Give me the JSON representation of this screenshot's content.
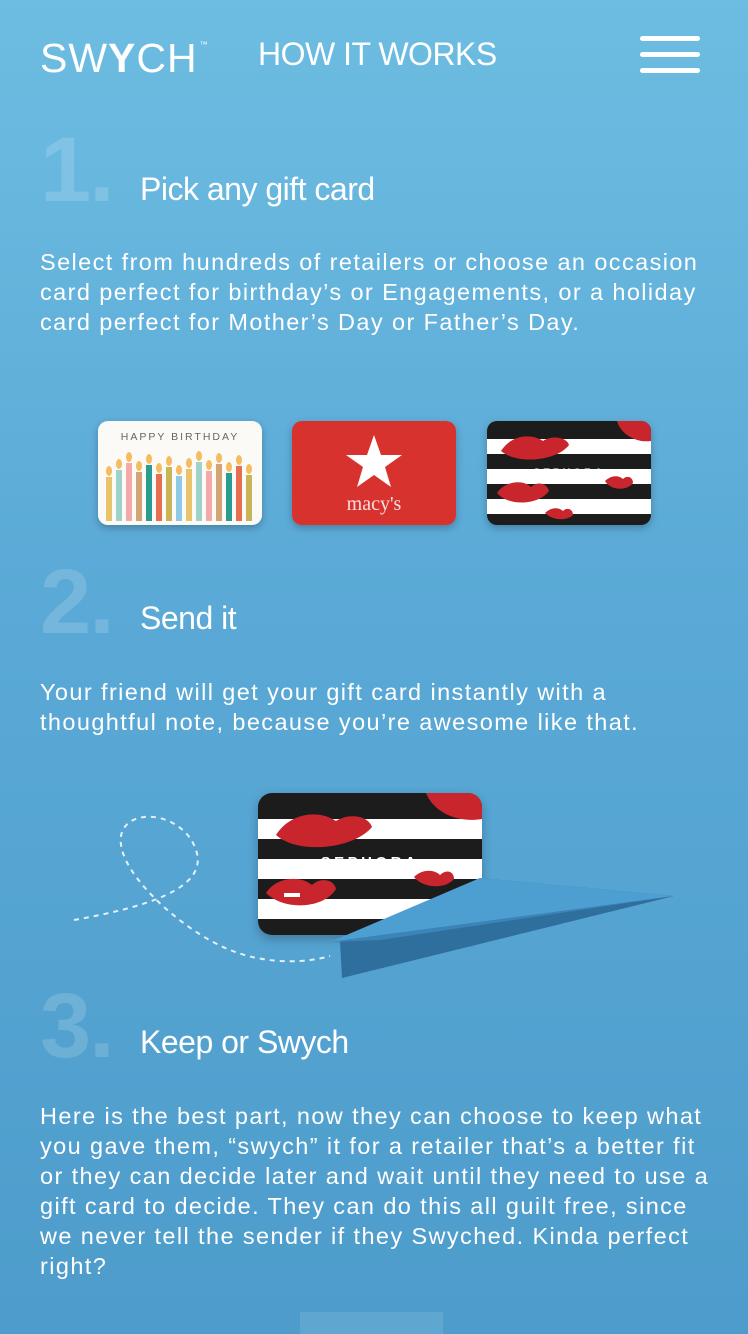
{
  "header": {
    "logo_text_left": "SW",
    "logo_text_y": "Y",
    "logo_text_right": "CH",
    "logo_trademark": "™",
    "title": "HOW IT WORKS",
    "menu_icon": "hamburger-menu-icon"
  },
  "steps": [
    {
      "number": "1.",
      "title": "Pick any gift card",
      "body": "Select from hundreds of retailers or choose an occasion card perfect for birthday’s or Engagements, or a holiday card perfect for Mother’s Day or Father’s Day."
    },
    {
      "number": "2.",
      "title": "Send it",
      "body": "Your friend will get your gift card instantly with a thoughtful note, because you’re awesome like that."
    },
    {
      "number": "3.",
      "title": "Keep or Swych",
      "body": "Here is the best part, now they can choose to keep what you gave them, “swych” it for a retailer that’s a better fit or they can decide later and wait until they need to use a gift card to decide. They can do this all guilt free, since we never tell the sender if they Swyched. Kinda perfect right?"
    }
  ],
  "cards": {
    "birthday_text": "HAPPY BIRTHDAY",
    "macys_text": "macy's",
    "sephora_text": "SEPHORA"
  },
  "colors": {
    "background_top": "#6dbde2",
    "background_bottom": "#4d9ccb",
    "macys_red": "#d7322e",
    "sephora_black": "#1c1c1c",
    "sephora_red": "#c8262c",
    "plane_light": "#4d9fd2",
    "plane_dark": "#2f6f9e"
  }
}
